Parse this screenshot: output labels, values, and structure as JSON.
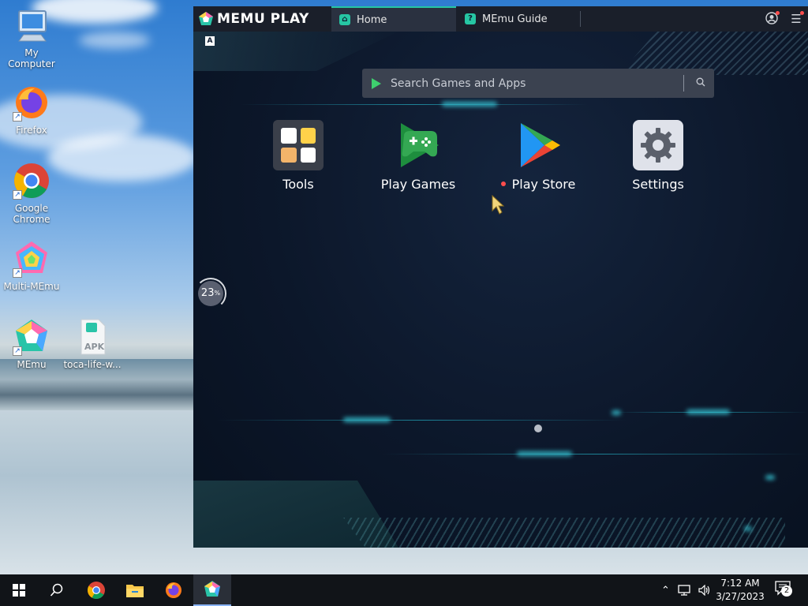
{
  "desktop": {
    "icons": [
      {
        "label": "My Computer",
        "icon": "computer-icon"
      },
      {
        "label": "Firefox",
        "icon": "firefox-icon"
      },
      {
        "label": "Google Chrome",
        "icon": "chrome-icon"
      },
      {
        "label": "Multi-MEmu",
        "icon": "multi-memu-icon"
      },
      {
        "label": "MEmu",
        "icon": "memu-icon"
      },
      {
        "label": "toca-life-w...",
        "icon": "apk-file-icon",
        "badge": "APK"
      }
    ]
  },
  "memu": {
    "brand": "MEMU PLAY",
    "tabs": [
      {
        "label": "Home",
        "active": true
      },
      {
        "label": "MEmu Guide",
        "active": false
      }
    ],
    "keyboard_badge": "A",
    "search": {
      "placeholder": "Search Games and Apps"
    },
    "apps": [
      {
        "label": "Tools",
        "icon": "tools-folder-icon"
      },
      {
        "label": "Play Games",
        "icon": "play-games-icon"
      },
      {
        "label": "Play Store",
        "icon": "play-store-icon",
        "new_dot": true
      },
      {
        "label": "Settings",
        "icon": "settings-gear-icon"
      }
    ],
    "perf_widget": {
      "value": "23",
      "unit": "%"
    }
  },
  "taskbar": {
    "pinned": [
      "start-icon",
      "search-icon",
      "chrome-icon",
      "file-explorer-icon",
      "firefox-icon",
      "memu-icon"
    ],
    "clock": {
      "time": "7:12 AM",
      "date": "3/27/2023"
    },
    "notifications_count": "2"
  },
  "colors": {
    "accent": "#26c6a3",
    "memu_bg": "#0d1a2e",
    "titlebar": "#1a1f2a",
    "taskbar": "#111418"
  }
}
